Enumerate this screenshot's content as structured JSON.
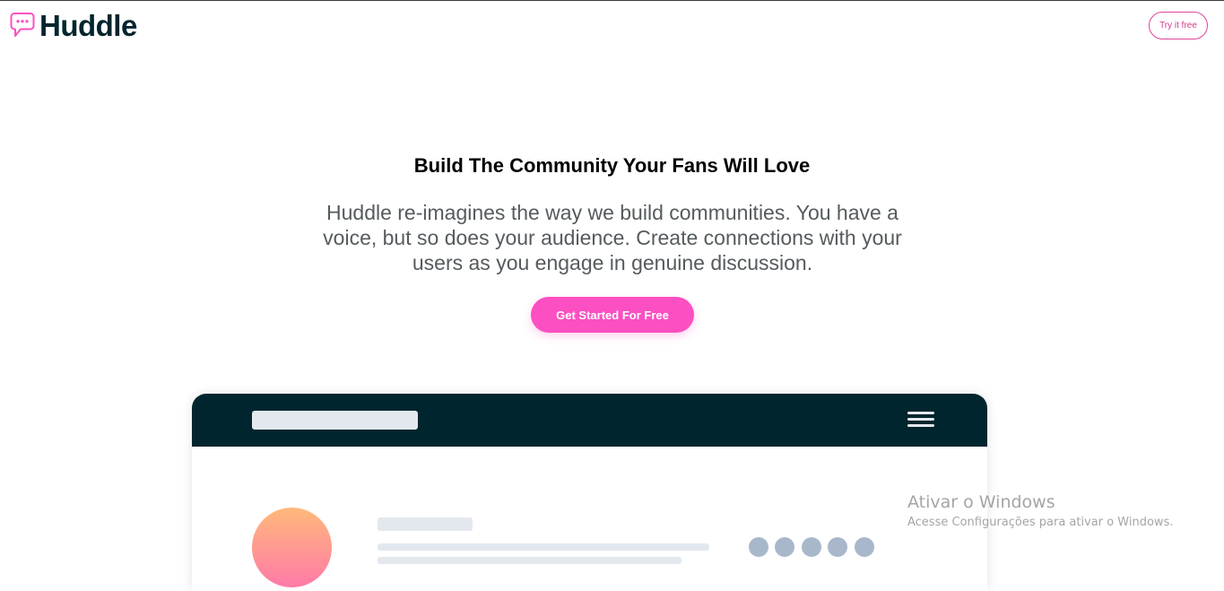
{
  "header": {
    "brand_name": "Huddle",
    "logo_icon": "chat-bubble-icon",
    "try_button_label": "Try it free"
  },
  "hero": {
    "title": "Build The Community Your Fans Will Love",
    "description": "Huddle re-imagines the way we build communities. You have a voice, but so does your audience. Create connections with your users as you engage in genuine discussion.",
    "cta_label": "Get Started For Free"
  },
  "mockup": {
    "menu_icon": "hamburger-menu-icon"
  },
  "watermark": {
    "title": "Ativar o Windows",
    "subtitle": "Acesse Configurações para ativar o Windows."
  },
  "colors": {
    "brand_dark": "#00252e",
    "accent_pink": "#fc4fc1",
    "placeholder_gray": "#e3e8ef",
    "dot_gray": "#a8b8ca"
  }
}
